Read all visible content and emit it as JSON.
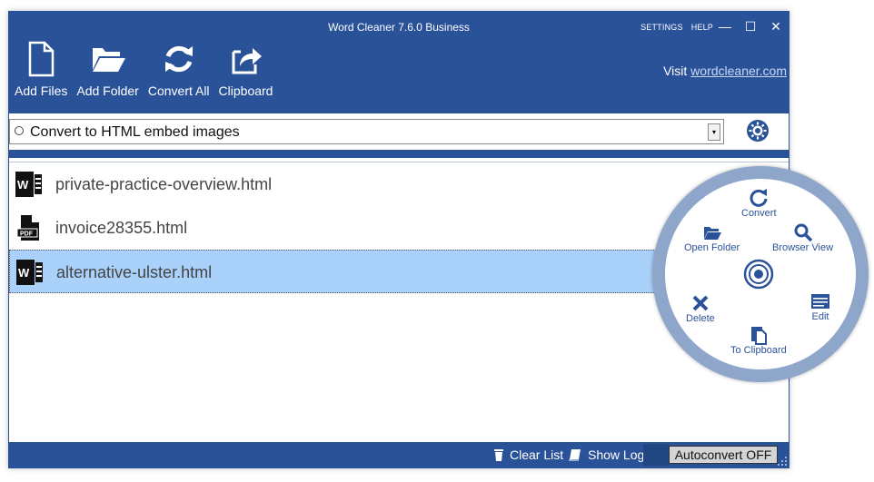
{
  "window": {
    "title": "Word Cleaner 7.6.0 Business",
    "menu": {
      "settings": "SETTINGS",
      "help": "HELP"
    },
    "controls": {
      "minimize": "—",
      "maximize": "☐",
      "close": "✕"
    }
  },
  "toolbar": {
    "add_files": "Add Files",
    "add_folder": "Add Folder",
    "convert_all": "Convert All",
    "clipboard": "Clipboard"
  },
  "visit": {
    "prefix": "Visit ",
    "link": "wordcleaner.com"
  },
  "conversion": {
    "selected": "Convert to HTML embed images",
    "dropdown_arrow": "▾"
  },
  "files": [
    {
      "name": "private-practice-overview.html",
      "icon": "word-file-icon"
    },
    {
      "name": "invoice28355.html",
      "icon": "pdf-file-icon"
    },
    {
      "name": "alternative-ulster.html",
      "icon": "word-file-icon"
    }
  ],
  "radial_menu": {
    "convert": "Convert",
    "open_folder": "Open Folder",
    "browser_view": "Browser View",
    "delete": "Delete",
    "edit": "Edit",
    "to_clipboard": "To Clipboard"
  },
  "statusbar": {
    "clear_list": "Clear List",
    "show_log": "Show Log",
    "autoconvert": "Autoconvert OFF"
  },
  "colors": {
    "brand": "#2a5299",
    "selected_row": "#a9d1fa",
    "radial_ring": "#8fa6cb"
  }
}
